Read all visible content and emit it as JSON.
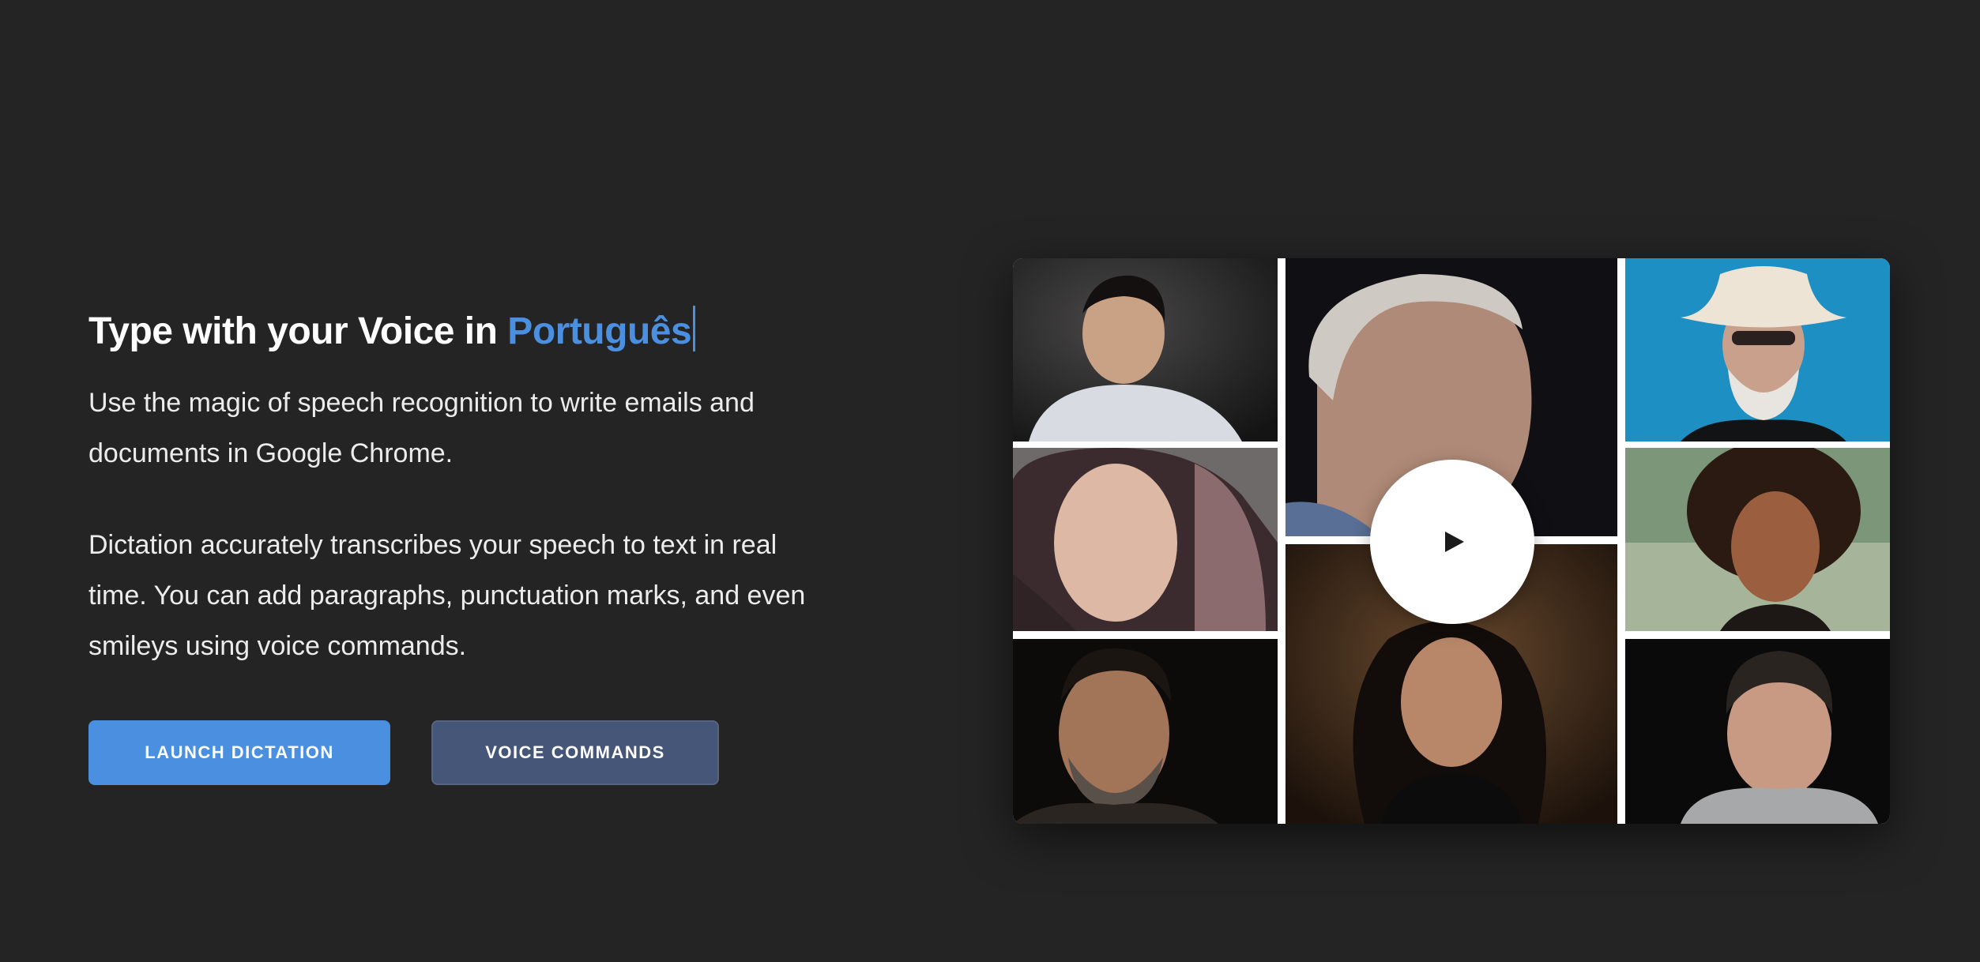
{
  "hero": {
    "headline_prefix": "Type with your Voice in ",
    "headline_language": "Português",
    "paragraph_1": "Use the magic of speech recognition to write emails and documents in Google Chrome.",
    "paragraph_2": "Dictation accurately transcribes your speech to text in real time. You can add paragraphs, punctuation marks, and even smileys using voice commands."
  },
  "buttons": {
    "launch_label": "LAUNCH DICTATION",
    "commands_label": "VOICE COMMANDS"
  },
  "colors": {
    "background": "#242424",
    "accent": "#4a8fe0",
    "secondary_button": "#465678"
  },
  "video": {
    "play_icon": "play-icon"
  }
}
